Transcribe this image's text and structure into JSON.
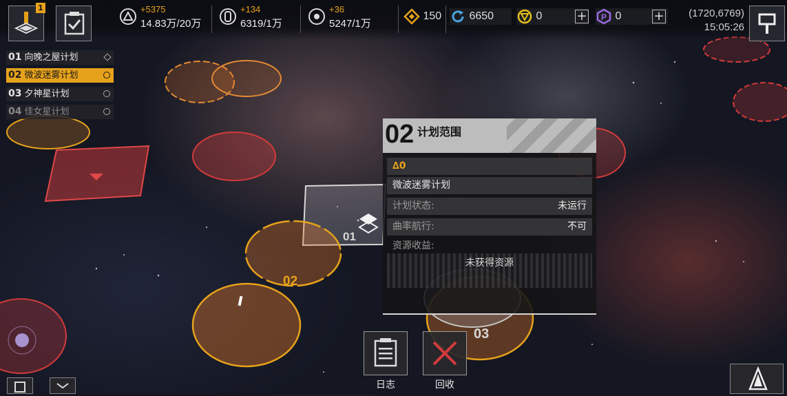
{
  "topbar": {
    "beacon_badge": "1",
    "resources": [
      {
        "icon": "triangle-icon",
        "delta": "+5375",
        "amount": "14.83万/20万"
      },
      {
        "icon": "crystal-icon",
        "delta": "+134",
        "amount": "6319/1万"
      },
      {
        "icon": "deuterium-icon",
        "delta": "+36",
        "amount": "5247/1万"
      }
    ],
    "currencies": [
      {
        "icon": "diamond-icon",
        "value": "150"
      },
      {
        "icon": "refresh-icon",
        "value": "6650"
      },
      {
        "icon": "token-icon",
        "value": "0"
      },
      {
        "icon": "purple-p-icon",
        "value": "0"
      }
    ],
    "coordinates": "(1720,6769)",
    "time": "15:05:26"
  },
  "plans": [
    {
      "num": "01",
      "name": "向晚之屋计划",
      "state": "normal"
    },
    {
      "num": "02",
      "name": "微波迷雾计划",
      "state": "active"
    },
    {
      "num": "03",
      "name": "夕神星计划",
      "state": "normal"
    },
    {
      "num": "04",
      "name": "佳女星计划",
      "state": "dim"
    }
  ],
  "map_labels": {
    "zone1": "01",
    "zone2": "02",
    "zone3": "03"
  },
  "panel": {
    "number": "02",
    "title": "计划范围",
    "warning": "∆0",
    "plan_name": "微波迷雾计划",
    "status_label": "计划状态:",
    "status_value": "未运行",
    "warp_label": "曲率航行:",
    "warp_value": "不可",
    "income_label": "资源收益:",
    "income_value": "未获得资源"
  },
  "buttons": {
    "log": "日志",
    "recycle": "回收"
  },
  "colors": {
    "accent": "#e7a21b",
    "hostile": "#d23b3b"
  }
}
